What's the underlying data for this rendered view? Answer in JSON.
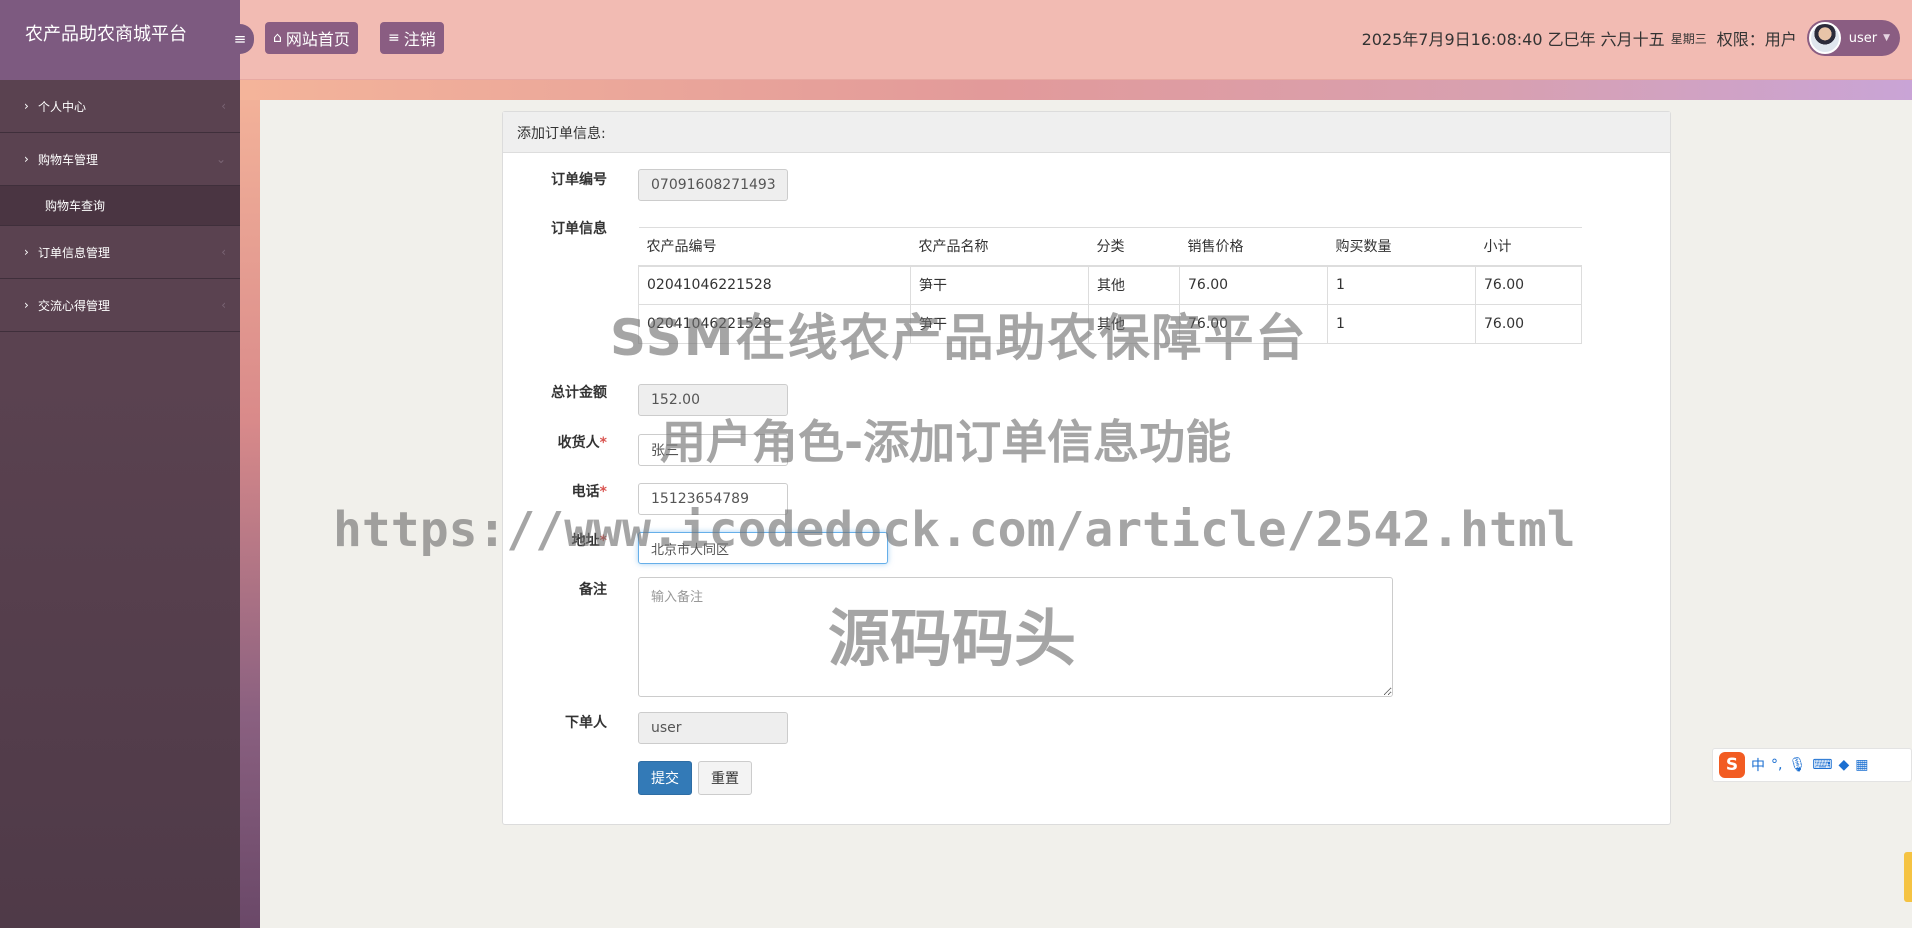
{
  "sidebar": {
    "brand": "农产品助农商城平台",
    "items": [
      {
        "label": "个人中心"
      },
      {
        "label": "购物车管理",
        "sub": [
          {
            "label": "购物车查询"
          }
        ]
      },
      {
        "label": "订单信息管理"
      },
      {
        "label": "交流心得管理"
      }
    ]
  },
  "topbar": {
    "toggle_icon": "bars-icon",
    "home_label": "网站首页",
    "logout_label": "注销",
    "datetime": "2025年7月9日16:08:40 乙巳年 六月十五",
    "weekday": "星期三",
    "role": "权限：用户",
    "username": "user"
  },
  "form": {
    "title": "添加订单信息:",
    "order_no_label": "订单编号",
    "order_no": "07091608271493",
    "order_info_label": "订单信息",
    "table": {
      "headers": [
        "农产品编号",
        "农产品名称",
        "分类",
        "销售价格",
        "购买数量",
        "小计"
      ],
      "rows": [
        [
          "02041046221528",
          "笋干",
          "其他",
          "76.00",
          "1",
          "76.00"
        ],
        [
          "02041046221528",
          "笋干",
          "其他",
          "76.00",
          "1",
          "76.00"
        ]
      ]
    },
    "total_label": "总计金额",
    "total": "152.00",
    "receiver_label": "收货人",
    "receiver": "张三",
    "phone_label": "电话",
    "phone": "15123654789",
    "address_label": "地址",
    "address": "北京市大同区",
    "remark_label": "备注",
    "remark_placeholder": "输入备注",
    "orderer_label": "下单人",
    "orderer": "user",
    "submit_label": "提交",
    "reset_label": "重置"
  },
  "watermark": {
    "line1": "SSM在线农产品助农保障平台",
    "line2": "用户角色-添加订单信息功能",
    "line3": "https://www.icodedock.com/article/2542.html",
    "line4": "源码码头"
  },
  "ime": {
    "logo": "S",
    "mode": "中",
    "punct": "°,",
    "mic_icon": "microphone-icon",
    "keyboard_icon": "keyboard-icon"
  }
}
